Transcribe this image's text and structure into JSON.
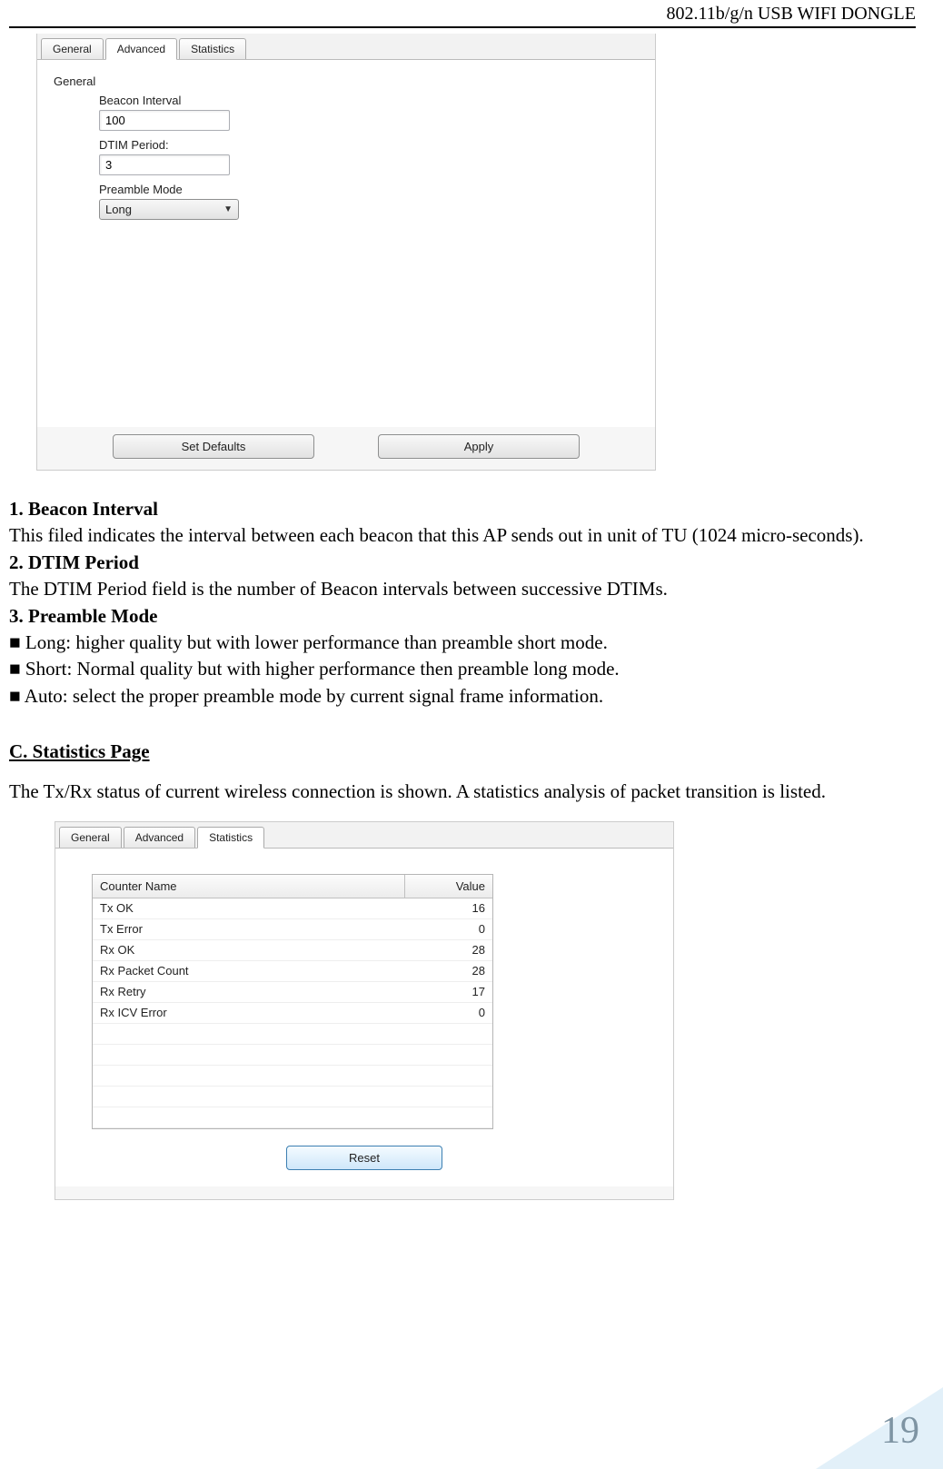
{
  "header": {
    "title": "802.11b/g/n USB WIFI DONGLE"
  },
  "page_number": "19",
  "screenshot1": {
    "tabs": {
      "general": "General",
      "advanced": "Advanced",
      "statistics": "Statistics",
      "active": "Advanced"
    },
    "group_label": "General",
    "fields": {
      "beacon": {
        "label": "Beacon Interval",
        "value": "100"
      },
      "dtim": {
        "label": "DTIM Period:",
        "value": "3"
      },
      "preamble": {
        "label": "Preamble Mode",
        "value": "Long"
      }
    },
    "buttons": {
      "defaults": "Set Defaults",
      "apply": "Apply"
    }
  },
  "doc": {
    "h1": "1. Beacon Interval",
    "p1": "This filed indicates the interval between each beacon that this AP sends out in unit of TU (1024 micro-seconds).",
    "h2": "2. DTIM Period",
    "p2": "The DTIM Period field is the number of Beacon intervals between successive DTIMs.",
    "h3": "3. Preamble Mode",
    "b1": "■ Long: higher quality but with lower performance than preamble short mode.",
    "b2": "■ Short: Normal quality but with higher performance then preamble long mode.",
    "b3": "■ Auto: select the proper preamble mode by current signal frame information.",
    "hC": "C. Statistics Page",
    "pC": "The Tx/Rx status of current wireless connection is shown. A statistics analysis of packet transition is listed."
  },
  "screenshot2": {
    "tabs": {
      "general": "General",
      "advanced": "Advanced",
      "statistics": "Statistics",
      "active": "Statistics"
    },
    "table": {
      "headers": {
        "name": "Counter Name",
        "value": "Value"
      },
      "rows": [
        {
          "name": "Tx OK",
          "value": "16"
        },
        {
          "name": "Tx Error",
          "value": "0"
        },
        {
          "name": "Rx OK",
          "value": "28"
        },
        {
          "name": "Rx Packet Count",
          "value": "28"
        },
        {
          "name": "Rx Retry",
          "value": "17"
        },
        {
          "name": "Rx ICV Error",
          "value": "0"
        }
      ],
      "empty_rows": 5
    },
    "reset_button": "Reset"
  }
}
